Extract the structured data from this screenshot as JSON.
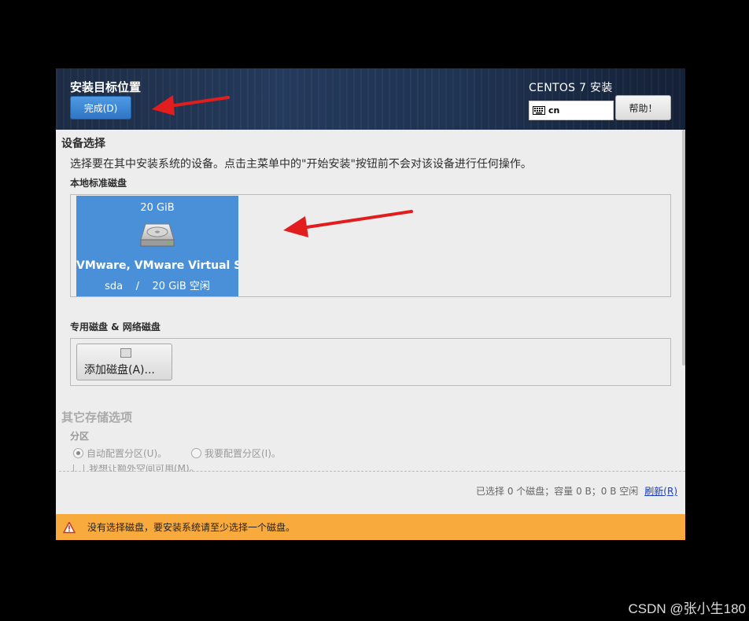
{
  "header": {
    "spoke_title": "安装目标位置",
    "done_label": "完成(D)",
    "product_title": "CENTOS 7 安装",
    "keyboard_layout": "cn",
    "help_label": "帮助！"
  },
  "device_selection": {
    "title": "设备选择",
    "description": "选择要在其中安装系统的设备。点击主菜单中的\"开始安装\"按钮前不会对该设备进行任何操作。",
    "local_disks_title": "本地标准磁盘",
    "disks": [
      {
        "size": "20 GiB",
        "name": "VMware, VMware Virtual S",
        "device": "sda",
        "separator": "/",
        "free": "20 GiB 空闲"
      }
    ],
    "special_disks_title": "专用磁盘 & 网络磁盘",
    "add_disk_label": "添加磁盘(A)..."
  },
  "other_options": {
    "title": "其它存储选项",
    "partition_label": "分区",
    "auto_partition": "自动配置分区(U)。",
    "manual_partition": "我要配置分区(I)。",
    "extra_space": "我想让额外空间可用(M)。"
  },
  "summary": {
    "text": "已选择 0 个磁盘；容量 0 B；0 B 空闲",
    "refresh_label": "刷新(R)"
  },
  "warning": {
    "text": "没有选择磁盘，要安装系统请至少选择一个磁盘。"
  },
  "watermark": "CSDN @张小生180",
  "colors": {
    "accent_blue": "#4a90d9",
    "warning_orange": "#f8aa3c",
    "annotation_red": "#e21d1d"
  }
}
